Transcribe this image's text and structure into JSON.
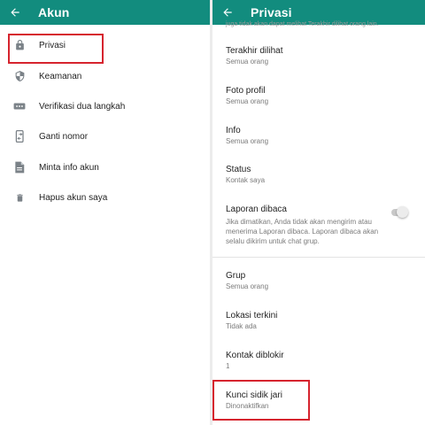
{
  "left_screen": {
    "title": "Akun",
    "items": [
      {
        "label": "Privasi",
        "icon": "lock-icon"
      },
      {
        "label": "Keamanan",
        "icon": "shield-icon"
      },
      {
        "label": "Verifikasi dua langkah",
        "icon": "dots-icon"
      },
      {
        "label": "Ganti nomor",
        "icon": "phone-change-icon"
      },
      {
        "label": "Minta info akun",
        "icon": "document-icon"
      },
      {
        "label": "Hapus akun saya",
        "icon": "trash-icon"
      }
    ]
  },
  "right_screen": {
    "title": "Privasi",
    "truncated_text": "juga tidak akan dapat melihat Terakhir dilihat orang lain.",
    "items": [
      {
        "title": "Terakhir dilihat",
        "subtitle": "Semua orang"
      },
      {
        "title": "Foto profil",
        "subtitle": "Semua orang"
      },
      {
        "title": "Info",
        "subtitle": "Semua orang"
      },
      {
        "title": "Status",
        "subtitle": "Kontak saya"
      },
      {
        "title": "Laporan dibaca",
        "subtitle": "Jika dimatikan, Anda tidak akan mengirim atau menerima Laporan dibaca. Laporan dibaca akan selalu dikirim untuk chat grup.",
        "toggle_on": false
      },
      {
        "title": "Grup",
        "subtitle": "Semua orang"
      },
      {
        "title": "Lokasi terkini",
        "subtitle": "Tidak ada"
      },
      {
        "title": "Kontak diblokir",
        "subtitle": "1"
      },
      {
        "title": "Kunci sidik jari",
        "subtitle": "Dinonaktifkan"
      }
    ]
  },
  "colors": {
    "appbar": "#128c7e",
    "highlight": "#d6242e",
    "icon": "#7b8288"
  }
}
